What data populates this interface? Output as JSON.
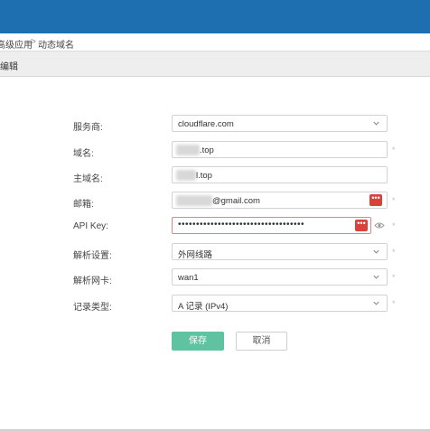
{
  "breadcrumb": {
    "parent": "高级应用",
    "separator": ">",
    "current": "动态域名"
  },
  "section": {
    "title": "编辑"
  },
  "form": {
    "provider": {
      "label": "服务商:",
      "value": "cloudflare.com",
      "icon": "chevron-down-icon"
    },
    "domain": {
      "label": "域名:",
      "value": ".top"
    },
    "main_domain": {
      "label": "主域名:",
      "value": "l.top"
    },
    "email": {
      "label": "邮箱:",
      "value": "@gmail.com",
      "icon": "password-manager-icon"
    },
    "api_key": {
      "label": "API Key:",
      "value": "•••••••••••••••••••••••••••••••••••",
      "icons": [
        "password-manager-icon",
        "eye-icon"
      ]
    },
    "resolve_setting": {
      "label": "解析设置:",
      "value": "外网线路",
      "icon": "chevron-down-icon"
    },
    "resolve_nic": {
      "label": "解析网卡:",
      "value": "wan1",
      "icon": "chevron-down-icon"
    },
    "record_type": {
      "label": "记录类型:",
      "value": "A 记录 (IPv4)",
      "icon": "chevron-down-icon"
    },
    "required_mark": "*"
  },
  "actions": {
    "save": "保存",
    "cancel": "取消"
  },
  "colors": {
    "topbar": "#1d6fb0",
    "save_button": "#5fc2a0",
    "password_icon": "#d9413b",
    "active_field_border": "#e08585"
  }
}
